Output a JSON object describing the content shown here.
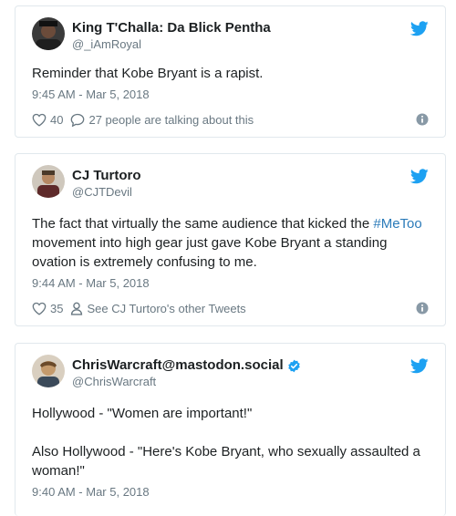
{
  "colors": {
    "text": "#1c2022",
    "secondary": "#697882",
    "link": "#2b7bb9",
    "twitter_blue": "#1da1f2",
    "border": "#e1e8ed"
  },
  "tweets": [
    {
      "display_name": "King T'Challa: Da Blick Pentha",
      "handle": "@_iAmRoyal",
      "verified": false,
      "text": "Reminder that Kobe Bryant is a rapist.",
      "timestamp": "9:45 AM - Mar 5, 2018",
      "likes": "40",
      "secondary_action": "27 people are talking about this",
      "secondary_icon": "speech-bubble-icon"
    },
    {
      "display_name": "CJ Turtoro",
      "handle": "@CJTDevil",
      "verified": false,
      "text_before": "The fact that virtually the same audience that kicked the ",
      "hashtag": "#MeToo",
      "text_after": " movement into high gear just gave Kobe Bryant a standing ovation is extremely confusing to me.",
      "timestamp": "9:44 AM - Mar 5, 2018",
      "likes": "35",
      "secondary_action": "See CJ Turtoro's other Tweets",
      "secondary_icon": "person-icon"
    },
    {
      "display_name": "ChrisWarcraft@mastodon.social",
      "handle": "@ChrisWarcraft",
      "verified": true,
      "text_line1": "Hollywood - \"Women are important!\"",
      "text_line2": "Also Hollywood - \"Here's Kobe Bryant, who sexually assaulted a woman!\"",
      "timestamp": "9:40 AM - Mar 5, 2018"
    }
  ]
}
